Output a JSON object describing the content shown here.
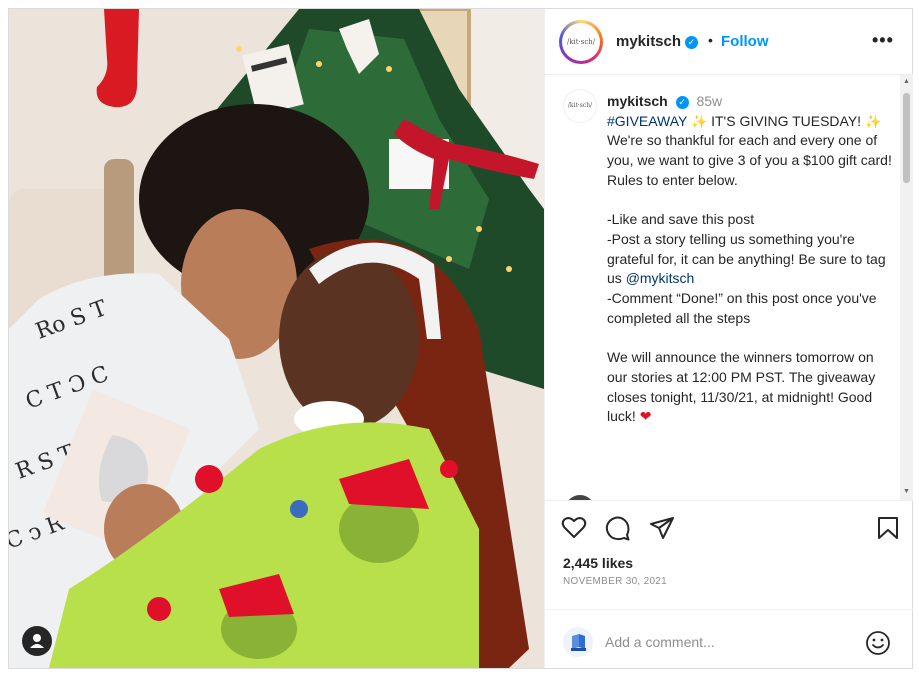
{
  "header": {
    "avatar_text": "/kit·sch/",
    "username": "mykitsch",
    "verified_mark": "✓",
    "separator": "•",
    "follow_label": "Follow",
    "more_label": "•••"
  },
  "caption": {
    "username": "mykitsch",
    "time": "85w",
    "hashtag": "#GIVEAWAY",
    "line_after_hashtag": "IT'S GIVING TUESDAY!",
    "line_thanks": "We're so thankful for each and every one of you, we want to give 3 of you a $100 gift card! Rules to enter below.",
    "rule_1": "-Like and save this post",
    "rule_2_before_tag": "-Post a story telling us something you're grateful for, it can be anything! Be sure to tag us",
    "mention": "@mykitsch",
    "rule_3": "-Comment “Done!” on this post once you've completed all the steps",
    "announce": "We will announce the winners tomorrow on our stories at 12:00 PM PST. The giveaway closes tonight, 11/30/21, at midnight! Good luck!",
    "sparkle_emoji": "✨",
    "heart_emoji": "❤"
  },
  "actions": {
    "likes": "2,445 likes",
    "date": "NOVEMBER 30, 2021"
  },
  "comment": {
    "placeholder": "Add a comment..."
  },
  "colors": {
    "accent": "#0095f6",
    "text": "#262626",
    "muted": "#8e8e8e",
    "link": "#00376b",
    "grinch_green": "#b8e04a"
  },
  "icons": [
    "user-tag-icon",
    "verified-icon",
    "more-icon",
    "heart-icon",
    "comment-icon",
    "share-icon",
    "bookmark-icon",
    "emoji-icon"
  ]
}
